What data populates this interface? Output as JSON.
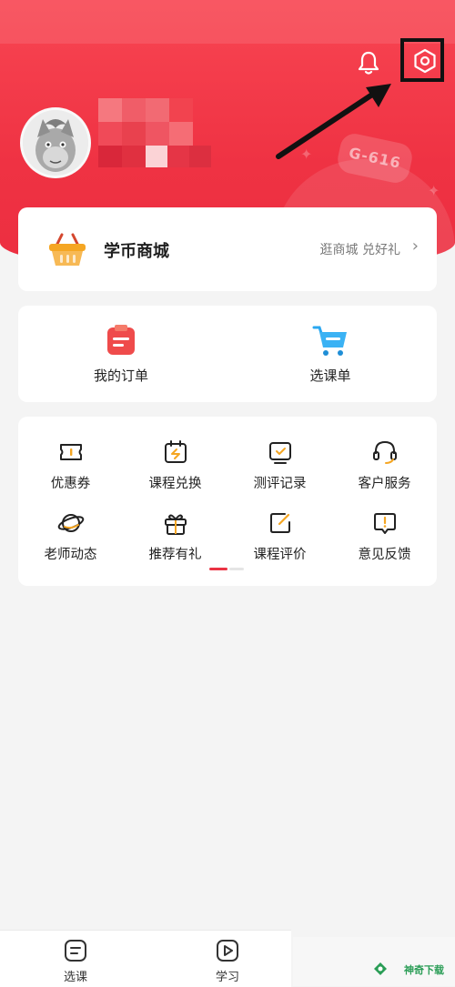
{
  "colors": {
    "brand_red": "#ef3243",
    "page_bg": "#f4f4f4",
    "card_bg": "#ffffff"
  },
  "header": {
    "icons": [
      "bell-icon",
      "settings-icon"
    ],
    "decor_tag": "G-616"
  },
  "shop": {
    "title": "学币商城",
    "subtitle": "逛商城 兑好礼",
    "chevron": "›"
  },
  "orders": {
    "items": [
      {
        "label": "我的订单",
        "icon": "order-list-icon"
      },
      {
        "label": "选课单",
        "icon": "cart-icon"
      }
    ]
  },
  "menu": {
    "items": [
      {
        "label": "优惠券",
        "icon": "coupon-icon"
      },
      {
        "label": "课程兑换",
        "icon": "calendar-exchange-icon"
      },
      {
        "label": "测评记录",
        "icon": "assessment-icon"
      },
      {
        "label": "客户服务",
        "icon": "headset-icon"
      },
      {
        "label": "老师动态",
        "icon": "planet-icon"
      },
      {
        "label": "推荐有礼",
        "icon": "gift-icon"
      },
      {
        "label": "课程评价",
        "icon": "edit-icon"
      },
      {
        "label": "意见反馈",
        "icon": "feedback-icon"
      }
    ],
    "pager": {
      "pages": 2,
      "active": 1
    }
  },
  "tabbar": {
    "tabs": [
      {
        "label": "选课",
        "icon": "course-list-icon"
      },
      {
        "label": "学习",
        "icon": "play-icon"
      }
    ]
  },
  "watermark": {
    "text": "神奇下载"
  }
}
